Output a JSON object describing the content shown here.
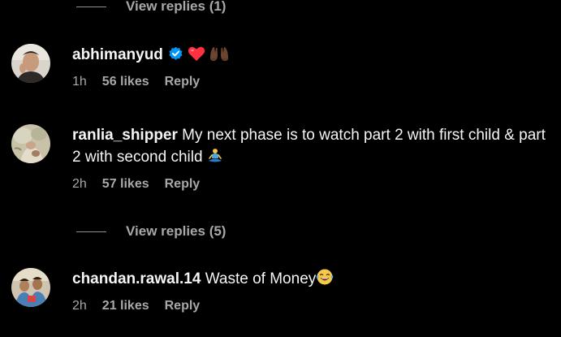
{
  "colors": {
    "background": "#000000",
    "primary_text": "#f5f5f5",
    "secondary_text": "#a8a8a8",
    "verified_badge": "#0095f6",
    "heart": "#ff3040"
  },
  "thread": {
    "view_replies_top": {
      "label": "View replies (1)"
    },
    "view_replies_mid": {
      "label": "View replies (5)"
    }
  },
  "comments": [
    {
      "username": "abhimanyud",
      "verified": true,
      "text": "",
      "emojis": [
        "red-heart",
        "raising-hands-dark-skin"
      ],
      "time": "1h",
      "likes": "56 likes",
      "reply": "Reply"
    },
    {
      "username": "ranlia_shipper",
      "verified": false,
      "text": "My next phase is to watch part 2 with first child & part 2 with second child",
      "emojis": [
        "person-in-lotus-position"
      ],
      "time": "2h",
      "likes": "57 likes",
      "reply": "Reply"
    },
    {
      "username": "chandan.rawal.14",
      "verified": false,
      "text": "Waste of Money",
      "emojis": [
        "face-with-tears-of-joy"
      ],
      "time": "2h",
      "likes": "21 likes",
      "reply": "Reply"
    }
  ]
}
